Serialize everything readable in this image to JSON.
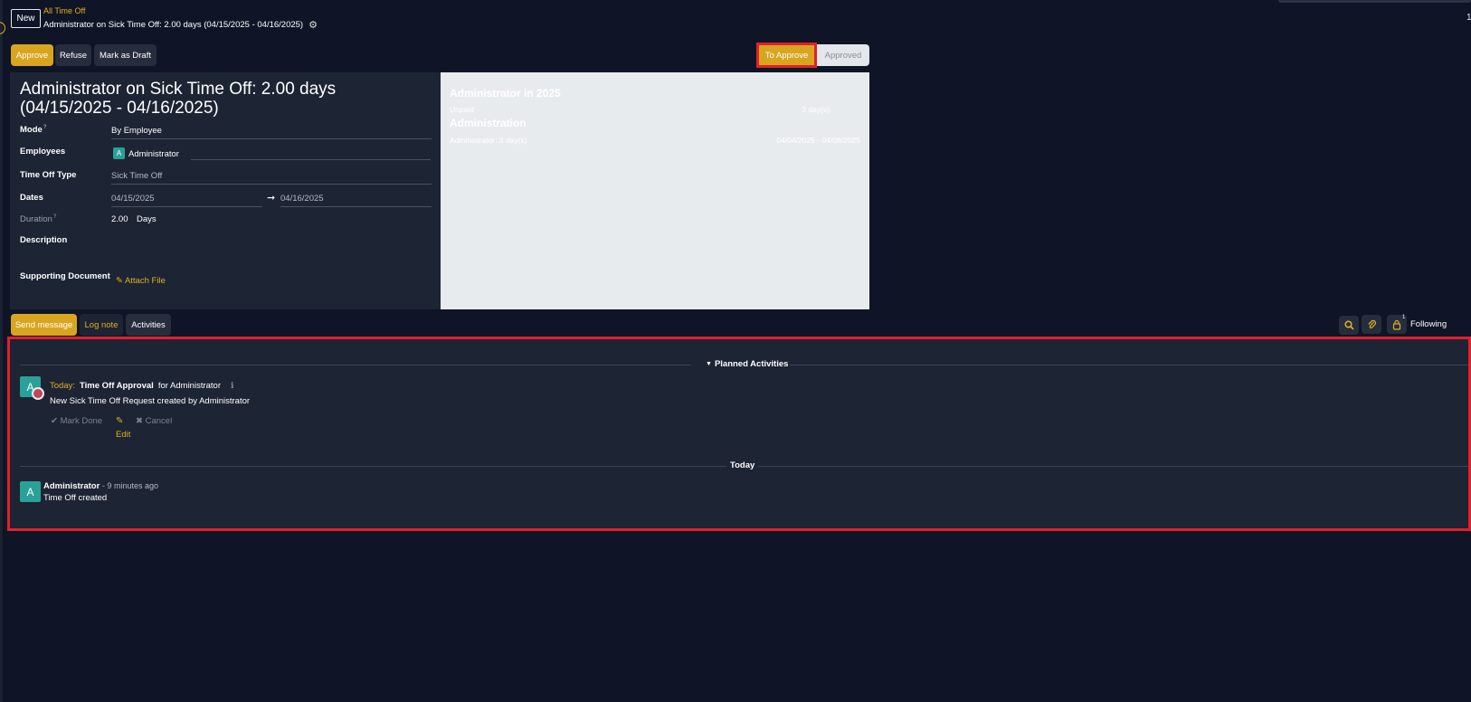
{
  "header": {
    "new_label": "New",
    "breadcrumb_parent": "All Time Off",
    "breadcrumb_title": "Administrator on Sick Time Off: 2.00 days (04/15/2025 - 04/16/2025)",
    "top_right_char": "1"
  },
  "actions": {
    "approve": "Approve",
    "refuse": "Refuse",
    "mark_draft": "Mark as Draft"
  },
  "status": {
    "to_approve": "To Approve",
    "approved": "Approved",
    "current": "To Approve"
  },
  "form": {
    "title": "Administrator on Sick Time Off: 2.00 days (04/15/2025 - 04/16/2025)",
    "mode_label": "Mode",
    "mode_help": "?",
    "mode_value": "By Employee",
    "employees_label": "Employees",
    "employee_initial": "A",
    "employee_name": "Administrator",
    "type_label": "Time Off Type",
    "type_value": "Sick Time Off",
    "dates_label": "Dates",
    "date_from": "04/15/2025",
    "date_arrow": "➞",
    "date_to": "04/16/2025",
    "duration_label": "Duration",
    "duration_help": "?",
    "duration_value": "2.00",
    "duration_unit": "Days",
    "description_label": "Description",
    "supporting_label": "Supporting Document",
    "attach_label": "Attach File"
  },
  "side_panel": {
    "title1": "Administrator in 2025",
    "row1_label": "Unpaid",
    "row1_value": "3 day(s)",
    "title2": "Administration",
    "row2_label": "Administrator: 3 day(s)",
    "row2_value": "04/04/2025 - 04/08/2025"
  },
  "chatter": {
    "send_message": "Send message",
    "log_note": "Log note",
    "activities": "Activities",
    "follower_count": "1",
    "following": "Following",
    "planned_header": "Planned Activities",
    "activity": {
      "avatar_initial": "A",
      "when": "Today:",
      "title": "Time Off Approval",
      "for_text": "for Administrator",
      "note": "New Sick Time Off Request created by Administrator",
      "mark_done": "Mark Done",
      "edit": "Edit",
      "cancel": "Cancel"
    },
    "today_header": "Today",
    "message": {
      "avatar_initial": "A",
      "author": "Administrator",
      "time": "- 9 minutes ago",
      "body": "Time Off created"
    }
  },
  "colors": {
    "accent": "#d9a520",
    "background": "#0f1526",
    "panel": "#1d2434",
    "highlight": "#e0202a",
    "avatar": "#2aa198"
  },
  "icons": {
    "gear": "gear-icon",
    "search": "search-icon",
    "clip": "paperclip-icon",
    "lock": "lock-icon",
    "caret": "caret-down-icon",
    "check": "check-icon",
    "pencil": "pencil-icon",
    "close": "close-icon",
    "info": "info-icon"
  }
}
